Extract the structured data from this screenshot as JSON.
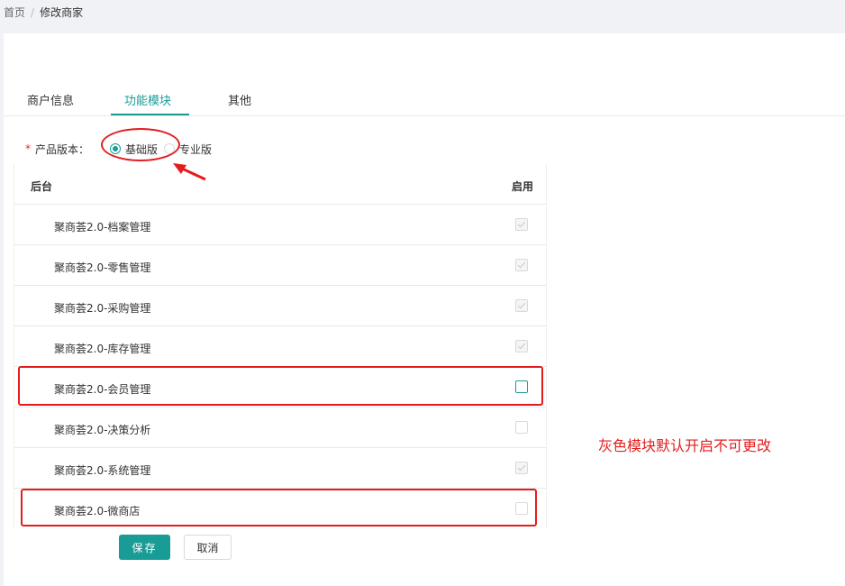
{
  "breadcrumb": {
    "home": "首页",
    "sep": "/",
    "current": "修改商家"
  },
  "tabs": [
    {
      "label": "商户信息"
    },
    {
      "label": "功能模块"
    },
    {
      "label": "其他"
    }
  ],
  "form": {
    "required_mark": "*",
    "label": "产品版本：",
    "options": [
      {
        "label": "基础版",
        "checked": true
      },
      {
        "label": "专业版",
        "checked": false
      }
    ]
  },
  "table": {
    "header_name": "后台",
    "header_enable": "启用",
    "rows": [
      {
        "name": "聚商荟2.0-档案管理",
        "state": "disabled-checked"
      },
      {
        "name": "聚商荟2.0-零售管理",
        "state": "disabled-checked"
      },
      {
        "name": "聚商荟2.0-采购管理",
        "state": "disabled-checked"
      },
      {
        "name": "聚商荟2.0-库存管理",
        "state": "disabled-checked"
      },
      {
        "name": "聚商荟2.0-会员管理",
        "state": "unchecked-focused"
      },
      {
        "name": "聚商荟2.0-决策分析",
        "state": "unchecked"
      },
      {
        "name": "聚商荟2.0-系统管理",
        "state": "disabled-checked"
      },
      {
        "name": "聚商荟2.0-微商店",
        "state": "unchecked"
      }
    ]
  },
  "buttons": {
    "save": "保存",
    "cancel": "取消"
  },
  "annotation": {
    "text": "灰色模块默认开启不可更改"
  },
  "colors": {
    "accent": "#1a9c96",
    "annotation": "#e31d1d"
  }
}
